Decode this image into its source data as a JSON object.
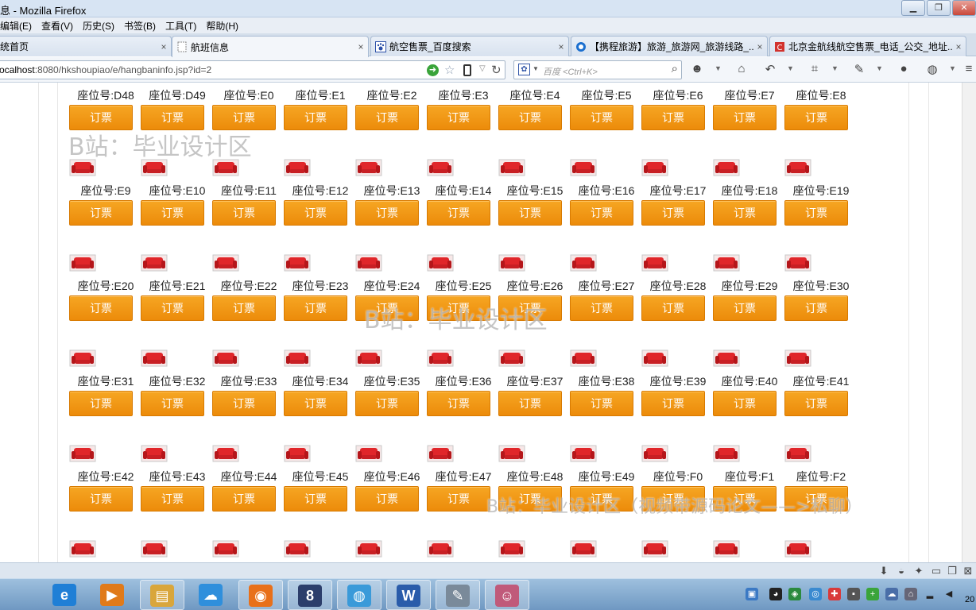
{
  "window": {
    "title": "息 - Mozilla Firefox",
    "minimize": "▁",
    "maximize": "❐",
    "close": "✕"
  },
  "menu": [
    "编辑(E)",
    "查看(V)",
    "历史(S)",
    "书签(B)",
    "工具(T)",
    "帮助(H)"
  ],
  "tabs": [
    {
      "label": "统首页",
      "icon": "page-icon"
    },
    {
      "label": "航班信息",
      "icon": "blank-page-icon",
      "active": true
    },
    {
      "label": "航空售票_百度搜索",
      "icon": "baidu-paw-icon"
    },
    {
      "label": "【携程旅游】旅游_旅游网_旅游线路_...",
      "icon": "ctrip-icon"
    },
    {
      "label": "北京金航线航空售票_电话_公交_地址...",
      "icon": "site-icon"
    }
  ],
  "nav": {
    "url_host": "ocalhost",
    "url_rest": ":8080/hkshoupiao/e/hangbaninfo.jsp?id=2",
    "search_placeholder": "百度 <Ctrl+K>"
  },
  "seats": {
    "button_label": "订票",
    "rows": [
      [
        "座位号:D48",
        "座位号:D49",
        "座位号:E0",
        "座位号:E1",
        "座位号:E2",
        "座位号:E3",
        "座位号:E4",
        "座位号:E5",
        "座位号:E6",
        "座位号:E7",
        "座位号:E8"
      ],
      [
        "座位号:E9",
        "座位号:E10",
        "座位号:E11",
        "座位号:E12",
        "座位号:E13",
        "座位号:E14",
        "座位号:E15",
        "座位号:E16",
        "座位号:E17",
        "座位号:E18",
        "座位号:E19"
      ],
      [
        "座位号:E20",
        "座位号:E21",
        "座位号:E22",
        "座位号:E23",
        "座位号:E24",
        "座位号:E25",
        "座位号:E26",
        "座位号:E27",
        "座位号:E28",
        "座位号:E29",
        "座位号:E30"
      ],
      [
        "座位号:E31",
        "座位号:E32",
        "座位号:E33",
        "座位号:E34",
        "座位号:E35",
        "座位号:E36",
        "座位号:E37",
        "座位号:E38",
        "座位号:E39",
        "座位号:E40",
        "座位号:E41"
      ],
      [
        "座位号:E42",
        "座位号:E43",
        "座位号:E44",
        "座位号:E45",
        "座位号:E46",
        "座位号:E47",
        "座位号:E48",
        "座位号:E49",
        "座位号:F0",
        "座位号:F1",
        "座位号:F2"
      ]
    ]
  },
  "watermarks": {
    "top_left": "B站：毕业设计区",
    "center": "B站：毕业设计区",
    "bottom": "B站：毕业设计区（视频带源码论文——>私聊）"
  },
  "taskbar": {
    "clock_fragment": "20",
    "apps": [
      {
        "name": "ie-icon",
        "glyph": "e",
        "color": "#1f7fd6"
      },
      {
        "name": "media-player-icon",
        "glyph": "▶",
        "color": "#e07a1a"
      },
      {
        "name": "file-explorer-icon",
        "glyph": "▤",
        "color": "#d9a63b"
      },
      {
        "name": "cloud-app-icon",
        "glyph": "☁",
        "color": "#2f8fdc"
      },
      {
        "name": "firefox-icon",
        "glyph": "◉",
        "color": "#e8701a"
      },
      {
        "name": "eclipse-icon",
        "glyph": "8",
        "color": "#2c3e6b"
      },
      {
        "name": "globe-icon",
        "glyph": "◍",
        "color": "#3a9ad9"
      },
      {
        "name": "word-icon",
        "glyph": "W",
        "color": "#2a5caa"
      },
      {
        "name": "tools-icon",
        "glyph": "✎",
        "color": "#7a8a9a"
      },
      {
        "name": "avatar-app-icon",
        "glyph": "☺",
        "color": "#c05a7a"
      }
    ]
  },
  "colors": {
    "book_button": "#f39c12",
    "seat_icon": "#e0262a"
  }
}
